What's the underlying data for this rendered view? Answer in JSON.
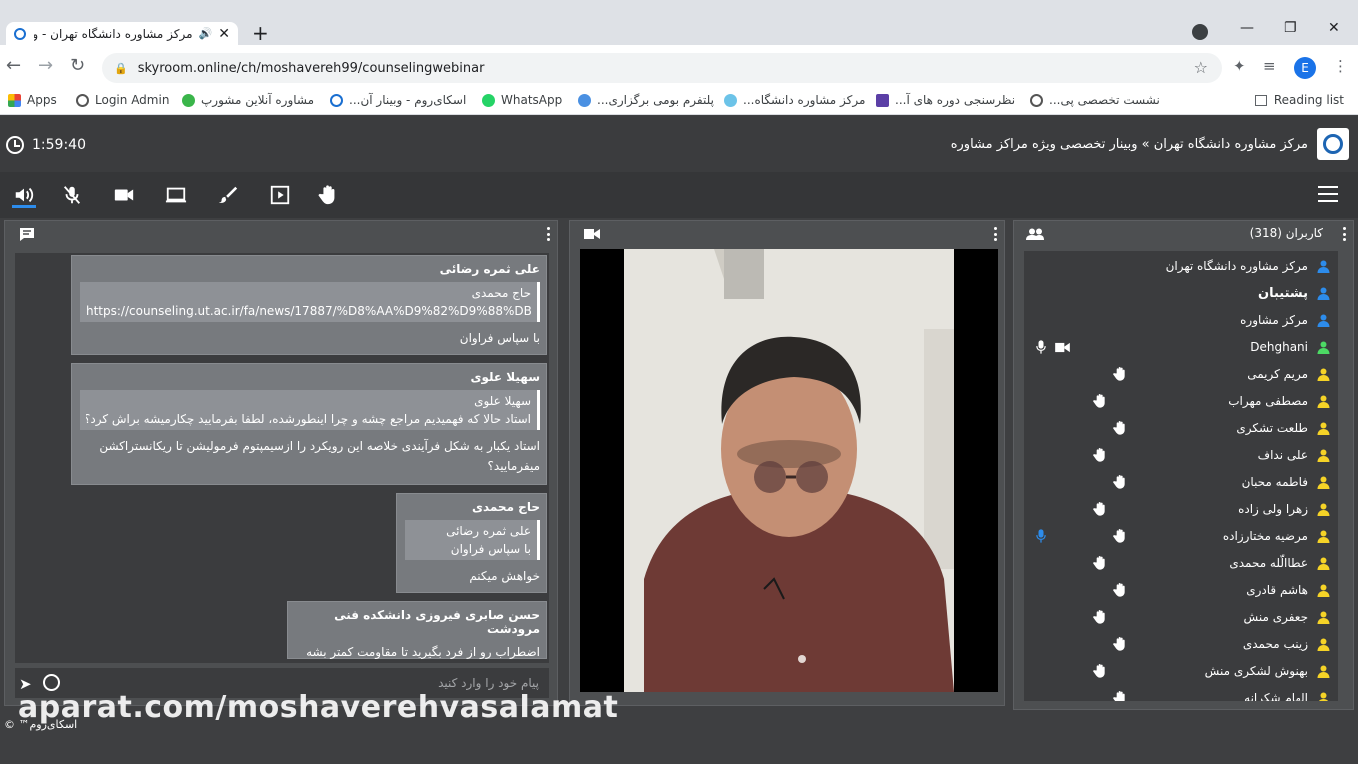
{
  "browser": {
    "tab_title": "مرکز مشاوره دانشگاه تهران - و",
    "url": "skyroom.online/ch/moshavereh99/counselingwebinar",
    "bookmarks": [
      {
        "label": "Apps"
      },
      {
        "label": "Login Admin"
      },
      {
        "label": "مشاوره آنلاین مشورپ"
      },
      {
        "label": "اسکای‌روم - وبینار آن..."
      },
      {
        "label": "WhatsApp"
      },
      {
        "label": "پلتفرم بومی برگزاری..."
      },
      {
        "label": "مرکز مشاوره دانشگاه..."
      },
      {
        "label": "نظرسنجی دوره های آ..."
      },
      {
        "label": "نشست تخصصی پی..."
      }
    ],
    "reading_list": "Reading list",
    "profile_initial": "E"
  },
  "app": {
    "timer": "1:59:40",
    "room_title": "مرکز مشاوره دانشگاه تهران » وبینار تخصصی ویژه مراکز مشاوره"
  },
  "chat": {
    "placeholder": "پیام خود را وارد کنید",
    "messages": [
      {
        "sender": "علی ثمره رضائی",
        "quote": [
          "حاج محمدی",
          "https://counseling.ut.ac.ir/fa/news/17887/%D8%AA%D9%82%D9%88%DB%8C..."
        ],
        "lines": [
          "با سپاس فراوان"
        ]
      },
      {
        "sender": "سهیلا علوی",
        "quote": [
          "سهیلا علوی",
          "استاد حالا که فهمیدیم مراجع چشه و چرا اینطورشده، لطفا بفرمایید چکارمیشه براش کرد؟"
        ],
        "lines": [
          "استاد یکبار به شکل فرآیندی خلاصه این رویکرد را ازسیمپتوم فرمولیشن تا ریکانستراکشن میفرمایید؟"
        ]
      },
      {
        "sender": "حاج محمدی",
        "quote": [
          "علی ثمره رضائی",
          "با سپاس فراوان"
        ],
        "lines": [
          "خواهش میکنم"
        ]
      },
      {
        "sender": "حسن صابری فیروزی دانشکده فنی مرودشت",
        "quote": [],
        "lines": [
          "اضطراب رو از فرد بگیرید تا مقاومت کمتر بشه"
        ]
      }
    ]
  },
  "users": {
    "title": "کاربران (318)",
    "list": [
      {
        "name": "مرکز مشاوره دانشگاه تهران",
        "color": "#2d8ceb",
        "bold": false,
        "hand": false,
        "mic": false,
        "cam": false
      },
      {
        "name": "پشتیبان",
        "color": "#2d8ceb",
        "bold": true,
        "hand": false,
        "mic": false,
        "cam": false
      },
      {
        "name": "مرکز مشاوره",
        "color": "#2d8ceb",
        "bold": false,
        "hand": false,
        "mic": false,
        "cam": false
      },
      {
        "name": "Dehghani",
        "color": "#4cd964",
        "bold": false,
        "hand": false,
        "mic": true,
        "cam": true
      },
      {
        "name": "مریم کریمی",
        "color": "#f5d327",
        "bold": false,
        "hand": true,
        "mic": false,
        "cam": false
      },
      {
        "name": "مصطفی مهراب",
        "color": "#f5d327",
        "bold": false,
        "hand": true,
        "mic": false,
        "cam": false
      },
      {
        "name": "طلعت تشکری",
        "color": "#f5d327",
        "bold": false,
        "hand": true,
        "mic": false,
        "cam": false
      },
      {
        "name": "علی نداف",
        "color": "#f5d327",
        "bold": false,
        "hand": true,
        "mic": false,
        "cam": false
      },
      {
        "name": "فاطمه محبان",
        "color": "#f5d327",
        "bold": false,
        "hand": true,
        "mic": false,
        "cam": false
      },
      {
        "name": "زهرا ولی زاده",
        "color": "#f5d327",
        "bold": false,
        "hand": true,
        "mic": false,
        "cam": false
      },
      {
        "name": "مرضیه مختارزاده",
        "color": "#f5d327",
        "bold": false,
        "hand": true,
        "mic": true,
        "cam": false
      },
      {
        "name": "عطاالّله محمدی",
        "color": "#f5d327",
        "bold": false,
        "hand": true,
        "mic": false,
        "cam": false
      },
      {
        "name": "هاشم قادری",
        "color": "#f5d327",
        "bold": false,
        "hand": true,
        "mic": false,
        "cam": false
      },
      {
        "name": "جعفری منش",
        "color": "#f5d327",
        "bold": false,
        "hand": true,
        "mic": false,
        "cam": false
      },
      {
        "name": "زینب محمدی",
        "color": "#f5d327",
        "bold": false,
        "hand": true,
        "mic": false,
        "cam": false
      },
      {
        "name": "بهنوش لشکری منش",
        "color": "#f5d327",
        "bold": false,
        "hand": true,
        "mic": false,
        "cam": false
      },
      {
        "name": "الهام شکرانه",
        "color": "#f5d327",
        "bold": false,
        "hand": true,
        "mic": false,
        "cam": false
      }
    ]
  },
  "watermark": "aparat.com/moshaverehvasalamat",
  "footer": "اسکای‌روم™ ©"
}
